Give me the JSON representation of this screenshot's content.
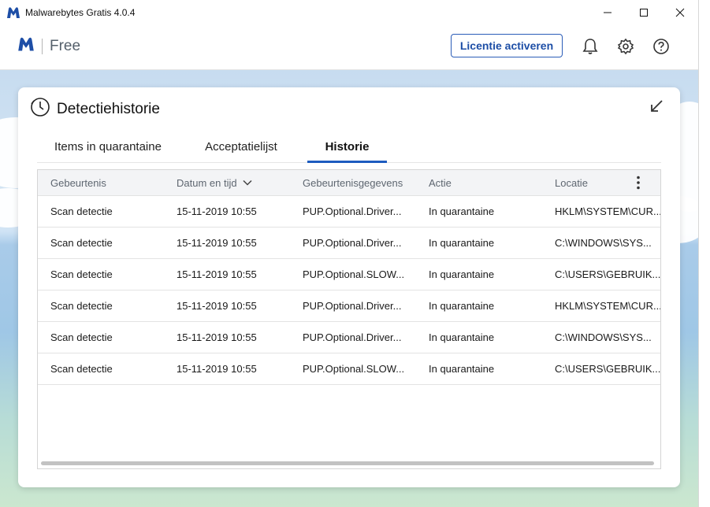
{
  "window": {
    "title": "Malwarebytes Gratis  4.0.4",
    "controls": [
      "minimize-icon",
      "maximize-icon",
      "close-icon"
    ]
  },
  "header": {
    "brand": "Free",
    "activate_label": "Licentie activeren",
    "icons": [
      "bell-icon",
      "gear-icon",
      "help-icon"
    ]
  },
  "dialog": {
    "title": "Detectiehistorie",
    "tabs": [
      {
        "label": "Items in quarantaine",
        "active": false
      },
      {
        "label": "Acceptatielijst",
        "active": false
      },
      {
        "label": "Historie",
        "active": true
      }
    ],
    "table": {
      "columns": [
        "Gebeurtenis",
        "Datum en tijd",
        "Gebeurtenisgegevens",
        "Actie",
        "Locatie"
      ],
      "sorted_column": "Datum en tijd",
      "rows": [
        {
          "event": "Scan detectie",
          "datetime": "15-11-2019 10:55",
          "details": "PUP.Optional.Driver...",
          "action": "In quarantaine",
          "location": "HKLM\\SYSTEM\\CUR..."
        },
        {
          "event": "Scan detectie",
          "datetime": "15-11-2019 10:55",
          "details": "PUP.Optional.Driver...",
          "action": "In quarantaine",
          "location": "C:\\WINDOWS\\SYS..."
        },
        {
          "event": "Scan detectie",
          "datetime": "15-11-2019 10:55",
          "details": "PUP.Optional.SLOW...",
          "action": "In quarantaine",
          "location": "C:\\USERS\\GEBRUIK..."
        },
        {
          "event": "Scan detectie",
          "datetime": "15-11-2019 10:55",
          "details": "PUP.Optional.Driver...",
          "action": "In quarantaine",
          "location": "HKLM\\SYSTEM\\CUR..."
        },
        {
          "event": "Scan detectie",
          "datetime": "15-11-2019 10:55",
          "details": "PUP.Optional.Driver...",
          "action": "In quarantaine",
          "location": "C:\\WINDOWS\\SYS..."
        },
        {
          "event": "Scan detectie",
          "datetime": "15-11-2019 10:55",
          "details": "PUP.Optional.SLOW...",
          "action": "In quarantaine",
          "location": "C:\\USERS\\GEBRUIK..."
        }
      ]
    }
  },
  "colors": {
    "brand_blue": "#1d4ea6",
    "tab_accent": "#1d5bbf"
  }
}
